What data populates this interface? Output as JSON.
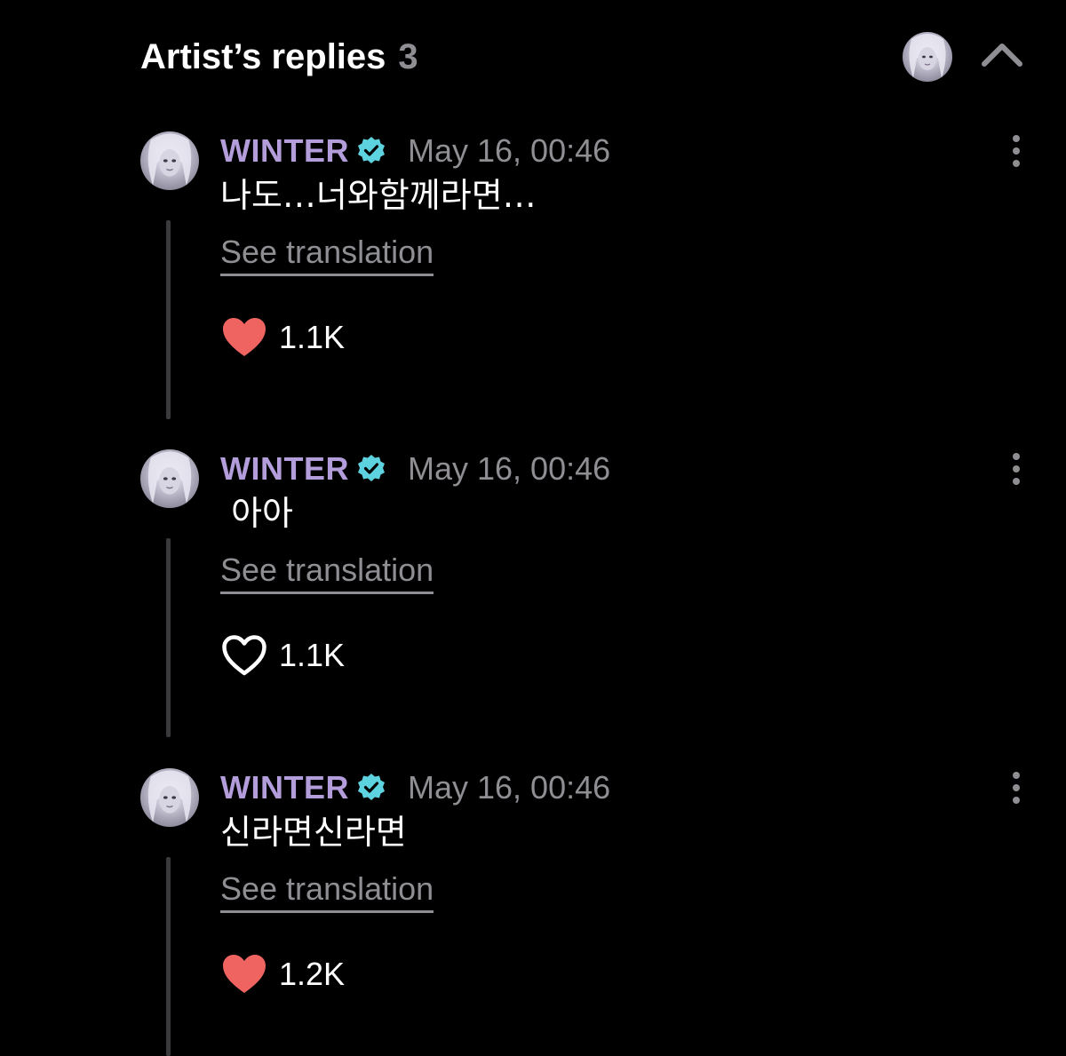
{
  "header": {
    "title": "Artist’s replies",
    "count": "3"
  },
  "replies": [
    {
      "author": "WINTER",
      "date": "May 16, 00:46",
      "text": "나도…너와함께라면…",
      "translate_label": "See translation",
      "likes": "1.1K",
      "liked": true
    },
    {
      "author": "WINTER",
      "date": "May 16, 00:46",
      "text": " 아아",
      "translate_label": "See translation",
      "likes": "1.1K",
      "liked": false
    },
    {
      "author": "WINTER",
      "date": "May 16, 00:46",
      "text": "신라면신라면",
      "translate_label": "See translation",
      "likes": "1.2K",
      "liked": true
    }
  ],
  "colors": {
    "background": "#000000",
    "name": "#b39ddb",
    "verified": "#5ed3e0",
    "muted": "#8e8e93",
    "heart_liked": "#ef6461",
    "thread_line": "#3a3a3c"
  },
  "icons": {
    "collapse": "chevron-up-icon",
    "more": "more-vertical-icon",
    "verified": "verified-badge-icon",
    "like": "heart-icon"
  }
}
